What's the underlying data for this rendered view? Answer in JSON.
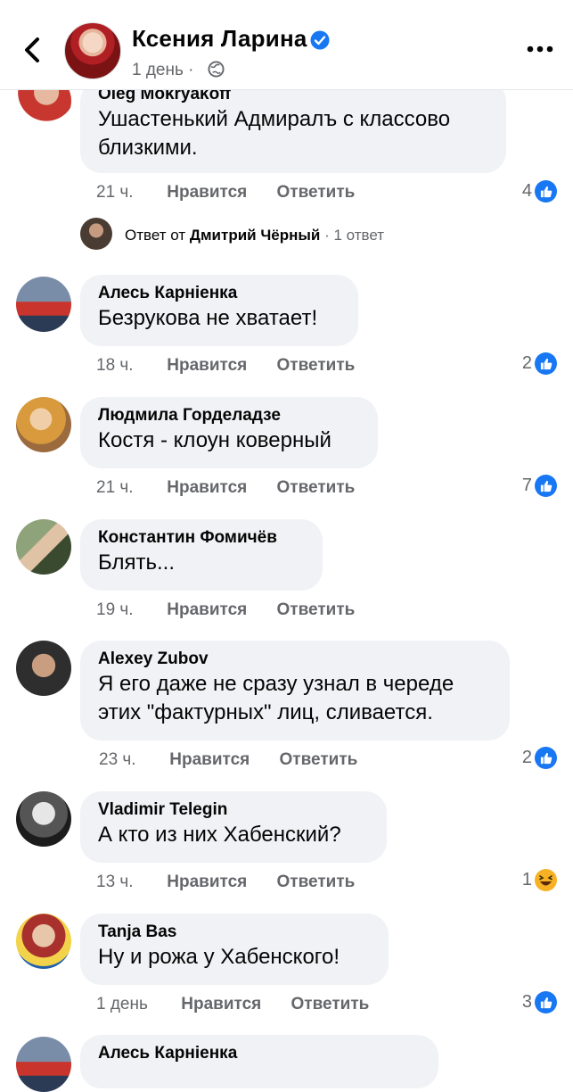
{
  "header": {
    "page_name": "Ксения Ларина",
    "post_time": "1 день ·",
    "back_icon": "chevron-left-icon",
    "more_icon": "more-horizontal-icon",
    "verified_color": "#1877f2"
  },
  "top_comment": {
    "author": "Oleg Mokryakoff",
    "text": "Ушастенький Адмиралъ с классово близкими.",
    "time": "21 ч.",
    "like_label": "Нравится",
    "reply_label": "Ответить",
    "reaction_count": "4",
    "reaction_type": "like"
  },
  "reply_thread": {
    "prefix": "Ответ от",
    "author": "Дмитрий Чёрный",
    "count": "· 1 ответ"
  },
  "comments": [
    {
      "author": "Алесь Карнiенка",
      "text": "Безрукова не хватает!",
      "time": "18 ч.",
      "like_label": "Нравится",
      "reply_label": "Ответить",
      "reaction_count": "2",
      "reaction_type": "like"
    },
    {
      "author": "Людмила Горделадзе",
      "text": "Костя - клоун коверный",
      "time": "21 ч.",
      "like_label": "Нравится",
      "reply_label": "Ответить",
      "reaction_count": "7",
      "reaction_type": "like"
    },
    {
      "author": "Константин Фомичёв",
      "text": "Блять...",
      "time": "19 ч.",
      "like_label": "Нравится",
      "reply_label": "Ответить",
      "reaction_count": "",
      "reaction_type": ""
    },
    {
      "author": "Alexey Zubov",
      "text": "Я его даже не сразу узнал в череде этих \"фактурных\" лиц, сливается.",
      "time": "23 ч.",
      "like_label": "Нравится",
      "reply_label": "Ответить",
      "reaction_count": "2",
      "reaction_type": "like"
    },
    {
      "author": "Vladimir Telegin",
      "text": "А кто из них Хабенский?",
      "time": "13 ч.",
      "like_label": "Нравится",
      "reply_label": "Ответить",
      "reaction_count": "1",
      "reaction_type": "haha"
    },
    {
      "author": "Tanja Bas",
      "text": "Ну и рожа у Хабенского!",
      "time": "1 день",
      "like_label": "Нравится",
      "reply_label": "Ответить",
      "reaction_count": "3",
      "reaction_type": "like"
    },
    {
      "author": "Алесь Карнiенка",
      "text": "",
      "time": "",
      "like_label": "",
      "reply_label": "",
      "reaction_count": "",
      "reaction_type": ""
    }
  ]
}
